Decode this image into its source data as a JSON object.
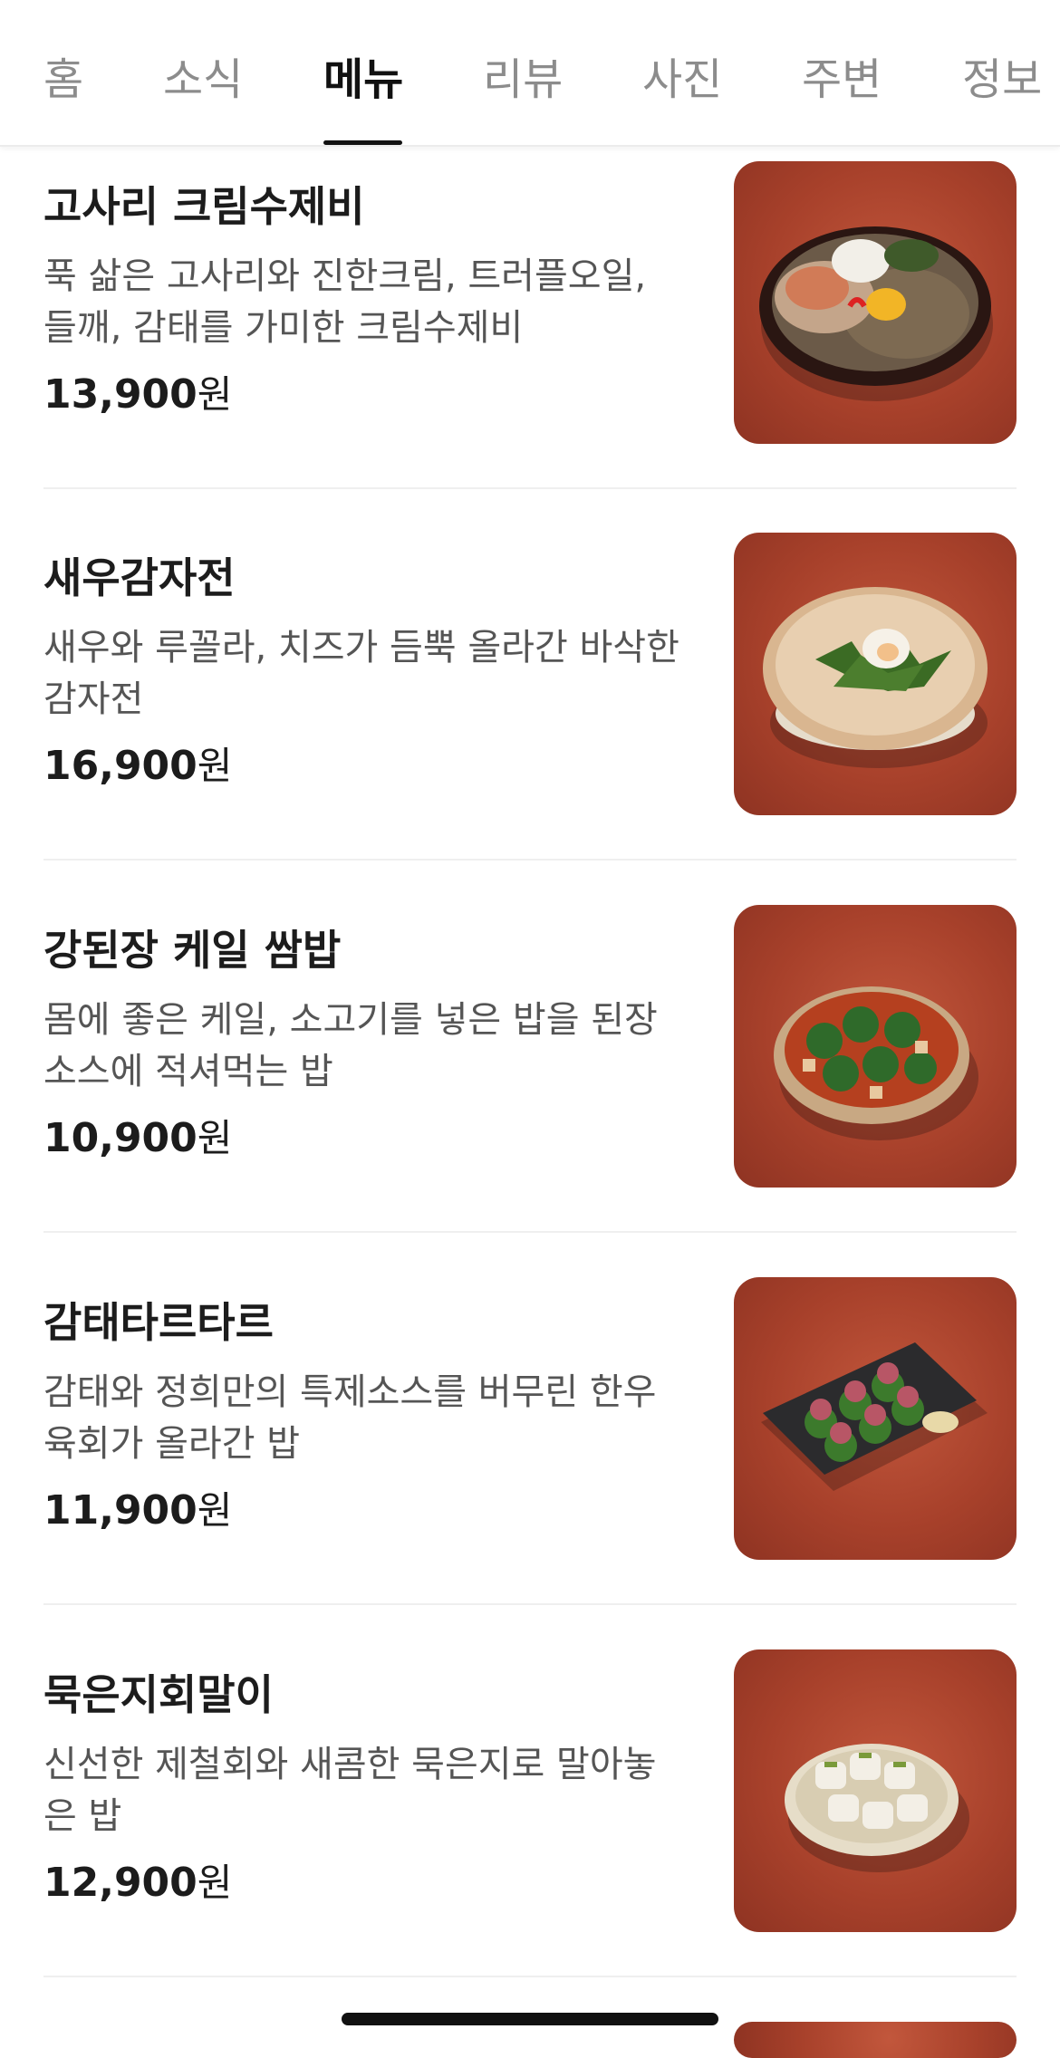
{
  "tabs": [
    {
      "label": "홈"
    },
    {
      "label": "소식"
    },
    {
      "label": "메뉴"
    },
    {
      "label": "리뷰"
    },
    {
      "label": "사진"
    },
    {
      "label": "주변"
    },
    {
      "label": "정보"
    }
  ],
  "active_tab": "메뉴",
  "currency_suffix": "원",
  "menu": [
    {
      "name": "고사리 크림수제비",
      "desc_line1": "푹 삶은 고사리와 진한크림, 트러플오일,",
      "desc_line2": "들깨, 감태를 가미한 크림수제비",
      "price": "13,900",
      "image_icon": "cream-sujebi-bowl"
    },
    {
      "name": "새우감자전",
      "desc_line1": "새우와 루꼴라, 치즈가 듬뿍 올라간 바삭한",
      "desc_line2": "감자전",
      "price": "16,900",
      "image_icon": "potato-pancake"
    },
    {
      "name": "강된장 케일 쌈밥",
      "desc_line1": "몸에 좋은 케일, 소고기를 넣은 밥을 된장",
      "desc_line2": "소스에 적셔먹는 밥",
      "price": "10,900",
      "image_icon": "kale-ssambap-bowl"
    },
    {
      "name": "감태타르타르",
      "desc_line1": "감태와 정희만의 특제소스를 버무린 한우",
      "desc_line2": "육회가 올라간 밥",
      "price": "11,900",
      "image_icon": "tartare-plate"
    },
    {
      "name": "묵은지회말이",
      "desc_line1": "신선한 제철회와 새콤한 묵은지로 말아놓",
      "desc_line2": "은 밥",
      "price": "12,900",
      "image_icon": "sashimi-roll-plate"
    }
  ],
  "colors": {
    "thumb_background": "#a8412b",
    "text_primary": "#1c1c1c",
    "text_secondary": "#555555",
    "tab_inactive": "#8c8c8c"
  }
}
